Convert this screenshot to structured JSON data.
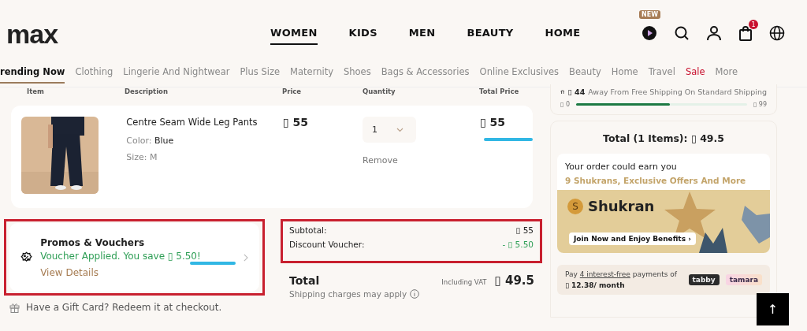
{
  "header": {
    "logo": "max",
    "nav": [
      {
        "label": "WOMEN",
        "selected": true
      },
      {
        "label": "KIDS",
        "selected": false
      },
      {
        "label": "MEN",
        "selected": false
      },
      {
        "label": "BEAUTY",
        "selected": false
      },
      {
        "label": "HOME",
        "selected": false
      }
    ],
    "new_badge": "NEW",
    "cart_count": "1"
  },
  "categories": [
    {
      "label": "rending Now",
      "selected": true,
      "kind": "normal"
    },
    {
      "label": "Clothing",
      "selected": false,
      "kind": "normal"
    },
    {
      "label": "Lingerie And Nightwear",
      "selected": false,
      "kind": "normal"
    },
    {
      "label": "Plus Size",
      "selected": false,
      "kind": "normal"
    },
    {
      "label": "Maternity",
      "selected": false,
      "kind": "normal"
    },
    {
      "label": "Shoes",
      "selected": false,
      "kind": "normal"
    },
    {
      "label": "Bags & Accessories",
      "selected": false,
      "kind": "normal"
    },
    {
      "label": "Online Exclusives",
      "selected": false,
      "kind": "normal"
    },
    {
      "label": "Beauty",
      "selected": false,
      "kind": "normal"
    },
    {
      "label": "Home",
      "selected": false,
      "kind": "normal"
    },
    {
      "label": "Travel",
      "selected": false,
      "kind": "normal"
    },
    {
      "label": "Sale",
      "selected": false,
      "kind": "sale"
    },
    {
      "label": "More",
      "selected": false,
      "kind": "normal"
    }
  ],
  "cart": {
    "columns": [
      "Item",
      "Description",
      "Price",
      "Quantity",
      "Total Price"
    ],
    "item": {
      "name": "Centre Seam Wide Leg Pants",
      "color_label": "Color:",
      "color_name": "Blue",
      "size_label": "Size:",
      "size": "M",
      "price": "▯ 55",
      "quantity": "1",
      "remove": "Remove",
      "total": "▯ 55",
      "total_underlined": true
    }
  },
  "promo": {
    "title": "Promos & Vouchers",
    "applied": "Voucher Applied. You save ▯ 5.50!",
    "applied_underlined": true,
    "details": "View Details",
    "highlighted": true
  },
  "summary": {
    "highlighted": true,
    "rows": [
      {
        "label": "Subtotal:",
        "value": "▯ 55",
        "kind": "plain"
      },
      {
        "label": "Discount Voucher:",
        "value": "- ▯ 5.50",
        "kind": "discount"
      }
    ],
    "total_label": "Total",
    "vat": "Including VAT",
    "total": "▯ 49.5",
    "shipping_note": "Shipping charges may apply"
  },
  "gift_card": "Have a Gift Card? Redeem it at checkout.",
  "shipping": {
    "amount": "▯ 44",
    "message": "Away From Free Shipping On Standard Shipping",
    "min": "▯ 0",
    "max": "▯ 99",
    "level": 0.55
  },
  "order_total": "Total (1 Items): ▯ 49.5",
  "shukran": {
    "intro": "Your order could earn you",
    "offer": "9 Shukrans, Exclusive Offers And More",
    "brand": "Shukran",
    "coin": "S",
    "cta": "Join Now and Enjoy Benefits ›"
  },
  "installments": {
    "text_before": "Pay ",
    "link": "4 interest-free",
    "text_after": " payments of",
    "amount": "▯ 12.38/ month",
    "providers": [
      "tabby",
      "tamara"
    ]
  },
  "scroll_top": "↑"
}
